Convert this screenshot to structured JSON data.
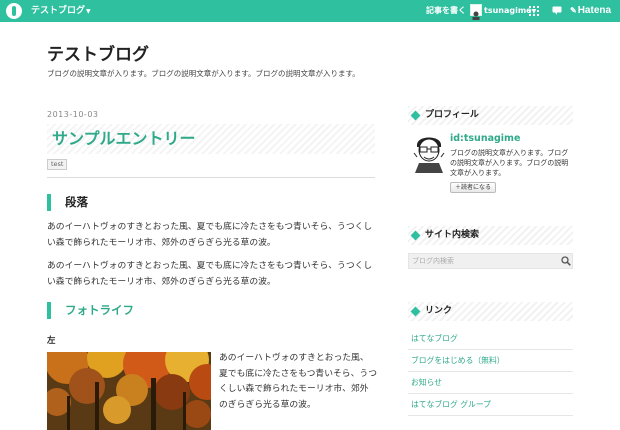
{
  "topbar": {
    "blog_menu": "テストブログ",
    "write_label": "記事を書く",
    "username": "tsunagime",
    "brand": "Hatena",
    "bg_color": "#2fc0a0"
  },
  "header": {
    "title": "テストブログ",
    "description": "ブログの説明文章が入ります。ブログの説明文章が入ります。ブログの説明文章が入ります。"
  },
  "entry": {
    "date": "2013-10-03",
    "title": "サンプルエントリー",
    "tag": "test",
    "sections": [
      {
        "heading": "段落",
        "paragraphs": [
          "あのイーハトヴォのすきとおった風、夏でも底に冷たさをもつ青いそら、うつくしい森で飾られたモーリオ市、郊外のぎらぎら光る草の波。",
          "あのイーハトヴォのすきとおった風、夏でも底に冷たさをもつ青いそら、うつくしい森で飾られたモーリオ市、郊外のぎらぎら光る草の波。"
        ]
      },
      {
        "heading": "フォトライフ",
        "subheading": "左",
        "photo_text": "あのイーハトヴォのすきとおった風、夏でも底に冷たさをもつ青いそら、うつくしい森で飾られたモーリオ市、郊外のぎらぎら光る草の波。"
      }
    ]
  },
  "sidebar": {
    "profile": {
      "heading": "プロフィール",
      "id": "id:tsunagime",
      "description": "ブログの説明文章が入ります。ブログの説明文章が入ります。ブログの説明文章が入ります。",
      "follow_label": "読者になる"
    },
    "search": {
      "heading": "サイト内検索",
      "placeholder": "ブログ内検索"
    },
    "links": {
      "heading": "リンク",
      "items": [
        {
          "label": "はてなブログ"
        },
        {
          "label": "ブログをはじめる（無料）"
        },
        {
          "label": "お知らせ"
        },
        {
          "label": "はてなブログ グループ"
        }
      ]
    }
  }
}
